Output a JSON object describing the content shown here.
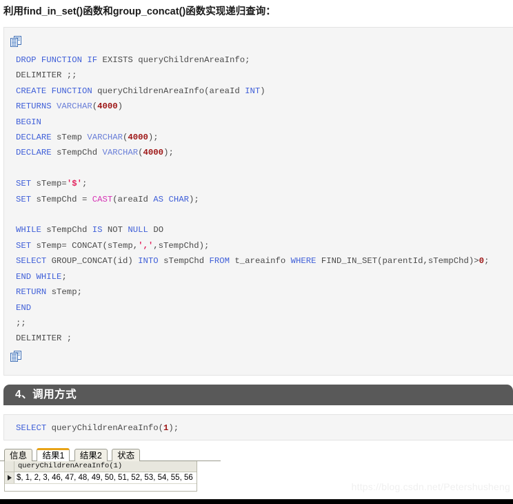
{
  "intro": {
    "text": "利用find_in_set()函数和group_concat()函数实现递归查询："
  },
  "copy_icon": {
    "name": "copy-to-clipboard-icon",
    "title": "复制"
  },
  "main_code": {
    "language": "sql",
    "lines": [
      "DROP FUNCTION IF EXISTS queryChildrenAreaInfo;",
      "DELIMITER ;;",
      "CREATE FUNCTION queryChildrenAreaInfo(areaId INT)",
      "RETURNS VARCHAR(4000)",
      "BEGIN",
      "DECLARE sTemp VARCHAR(4000);",
      "DECLARE sTempChd VARCHAR(4000);",
      "",
      "SET sTemp='$';",
      "SET sTempChd = CAST(areaId AS CHAR);",
      "",
      "WHILE sTempChd IS NOT NULL DO",
      "SET sTemp= CONCAT(sTemp,',',sTempChd);",
      "SELECT GROUP_CONCAT(id) INTO sTempChd FROM t_areainfo WHERE FIND_IN_SET(parentId,sTempChd)>0;",
      "END WHILE;",
      "RETURN sTemp;",
      "END",
      ";;",
      "DELIMITER ;"
    ]
  },
  "section": {
    "title": "4、调用方式"
  },
  "call_code": {
    "lines": [
      "SELECT queryChildrenAreaInfo(1);"
    ]
  },
  "result_panel": {
    "tabs": [
      {
        "label": "信息",
        "active": false
      },
      {
        "label": "结果1",
        "active": true
      },
      {
        "label": "结果2",
        "active": false
      },
      {
        "label": "状态",
        "active": false
      }
    ],
    "grid": {
      "columns": [
        "queryChildrenAreaInfo(1)"
      ],
      "rows": [
        [
          "$, 1, 2, 3, 46, 47, 48, 49, 50, 51, 52, 53, 54, 55, 56"
        ]
      ]
    }
  },
  "watermark": {
    "text": "https://blog.csdn.net/Petershusheng"
  },
  "colors": {
    "code_bg": "#f5f5f5",
    "code_border": "#e3e3e3",
    "keyword": "#3f5fd8",
    "number": "#9d1414",
    "string": "#e2245e",
    "function": "#d633b5",
    "section_header_bg": "#595959",
    "active_tab_accent": "#e8a317"
  }
}
